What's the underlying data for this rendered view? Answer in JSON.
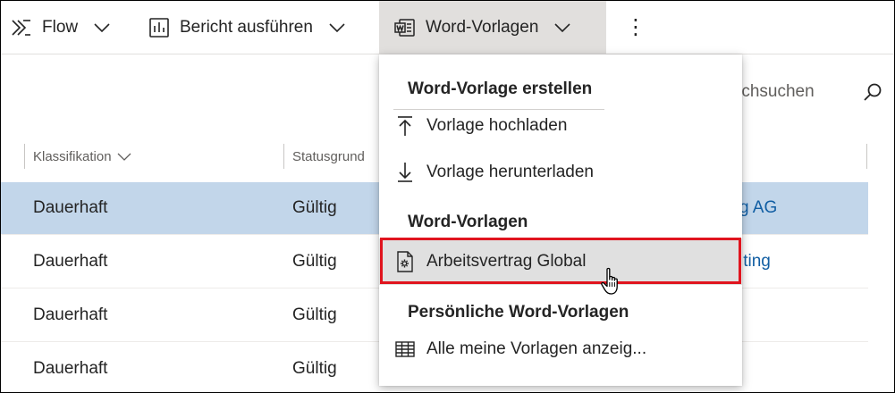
{
  "toolbar": {
    "flow_label": "Flow",
    "report_label": "Bericht ausführen",
    "word_templates_label": "Word-Vorlagen",
    "more_label": "⋮"
  },
  "search": {
    "visible_text": "rchsuchen"
  },
  "grid": {
    "columns": [
      "Klassifikation",
      "Statusgrund"
    ],
    "rows": [
      {
        "klassifikation": "Dauerhaft",
        "status": "Gültig",
        "partial": "g AG",
        "selected": true
      },
      {
        "klassifikation": "Dauerhaft",
        "status": "Gültig",
        "partial": "lting",
        "selected": false
      },
      {
        "klassifikation": "Dauerhaft",
        "status": "Gültig",
        "partial": "",
        "selected": false
      },
      {
        "klassifikation": "Dauerhaft",
        "status": "Gültig",
        "partial": "",
        "selected": false
      }
    ]
  },
  "menu": {
    "header_create": "Word-Vorlage erstellen",
    "upload": "Vorlage hochladen",
    "download": "Vorlage herunterladen",
    "header_templates": "Word-Vorlagen",
    "template_item": "Arbeitsvertrag Global",
    "header_personal": "Persönliche Word-Vorlagen",
    "all_templates": "Alle meine Vorlagen anzeig..."
  },
  "colors": {
    "selected_row": "#c2d6ea",
    "highlight_border": "#e0141e",
    "link": "#115ea3",
    "hover_bg": "#e0e0e0"
  },
  "icons": {
    "flow": "flow-icon",
    "report": "report-icon",
    "word": "word-icon",
    "search": "search-icon",
    "upload": "upload-arrow-icon",
    "download": "download-arrow-icon",
    "template": "document-gear-icon",
    "table": "table-grid-icon",
    "cursor": "hand-pointer-icon"
  }
}
